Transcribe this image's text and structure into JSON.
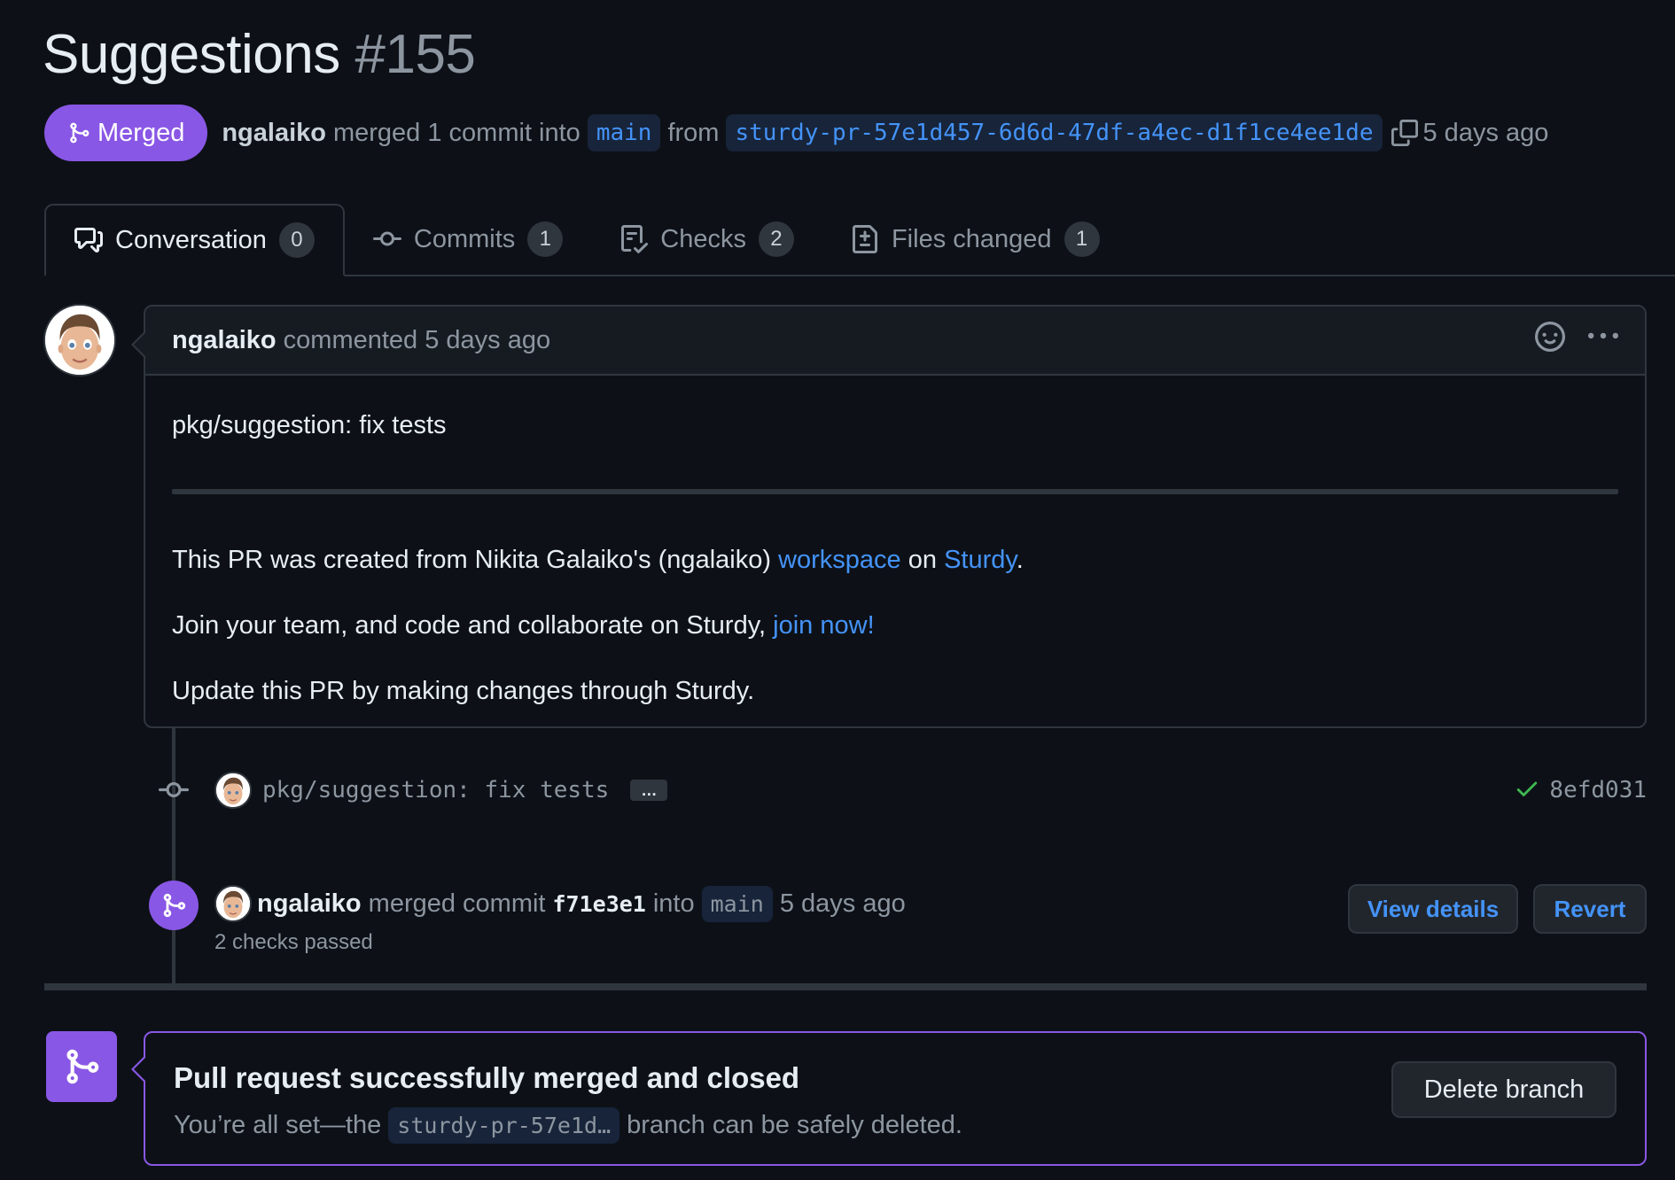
{
  "pr": {
    "title": "Suggestions",
    "number": "#155",
    "status_label": "Merged",
    "author": "ngalaiko",
    "merged_text": "merged 1 commit into",
    "base_branch": "main",
    "from_text": "from",
    "head_branch": "sturdy-pr-57e1d457-6d6d-47df-a4ec-d1f1ce4ee1de",
    "time_ago": "5 days ago"
  },
  "tabs": [
    {
      "label": "Conversation",
      "count": "0",
      "icon": "comment-discussion-icon",
      "active": true
    },
    {
      "label": "Commits",
      "count": "1",
      "icon": "git-commit-icon",
      "active": false
    },
    {
      "label": "Checks",
      "count": "2",
      "icon": "checklist-icon",
      "active": false
    },
    {
      "label": "Files changed",
      "count": "1",
      "icon": "file-diff-icon",
      "active": false
    }
  ],
  "comment": {
    "author": "ngalaiko",
    "action": "commented 5 days ago",
    "line1": "pkg/suggestion: fix tests",
    "p1_before": "This PR was created from Nikita Galaiko's (ngalaiko) ",
    "p1_link1": "workspace",
    "p1_mid": " on ",
    "p1_link2": "Sturdy",
    "p1_end": ".",
    "p2_before": "Join your team, and code and collaborate on Sturdy, ",
    "p2_link": "join now!",
    "p3": "Update this PR by making changes through Sturdy."
  },
  "commit": {
    "message": "pkg/suggestion: fix tests",
    "ellipsis": "…",
    "sha": "8efd031",
    "status": "success"
  },
  "merge_event": {
    "author": "ngalaiko",
    "text1": "merged commit",
    "sha": "f71e3e1",
    "text2": "into",
    "branch": "main",
    "time": "5 days ago",
    "checks": "2 checks passed",
    "view_details_label": "View details",
    "revert_label": "Revert"
  },
  "merged_box": {
    "title": "Pull request successfully merged and closed",
    "sub_before": "You’re all set—the",
    "branch_short": "sturdy-pr-57e1d…",
    "sub_after": "branch can be safely deleted.",
    "delete_label": "Delete branch"
  },
  "colors": {
    "background": "#0d1117",
    "merged_purple": "#8957e5",
    "link_blue": "#4493f8",
    "border": "#30363d",
    "success_green": "#3fb950"
  }
}
